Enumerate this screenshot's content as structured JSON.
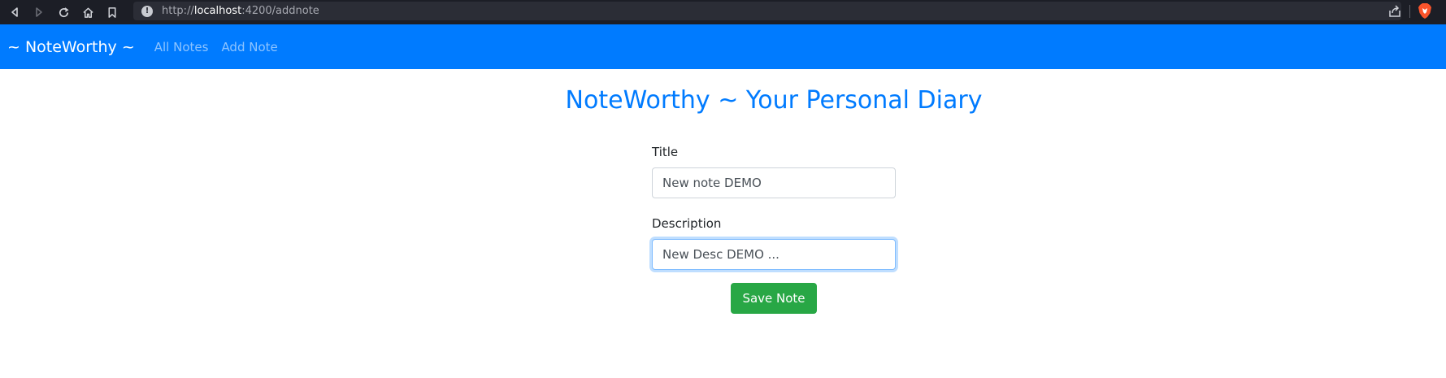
{
  "browser": {
    "url_scheme": "http://",
    "url_host": "localhost",
    "url_path": ":4200/addnote",
    "icons": [
      "back-icon",
      "forward-icon",
      "reload-icon",
      "home-icon",
      "bookmark-icon",
      "info-icon",
      "share-icon",
      "brave-icon"
    ]
  },
  "navbar": {
    "brand": "~ NoteWorthy ~",
    "links": [
      "All Notes",
      "Add Note"
    ],
    "background": "#007bff"
  },
  "main": {
    "title": "NoteWorthy ~ Your Personal Diary",
    "title_color": "#007bff",
    "form": {
      "title_label": "Title",
      "title_value": "New note DEMO",
      "description_label": "Description",
      "description_value": "New Desc DEMO ...",
      "submit_label": "Save Note",
      "submit_color": "#28a745"
    }
  }
}
